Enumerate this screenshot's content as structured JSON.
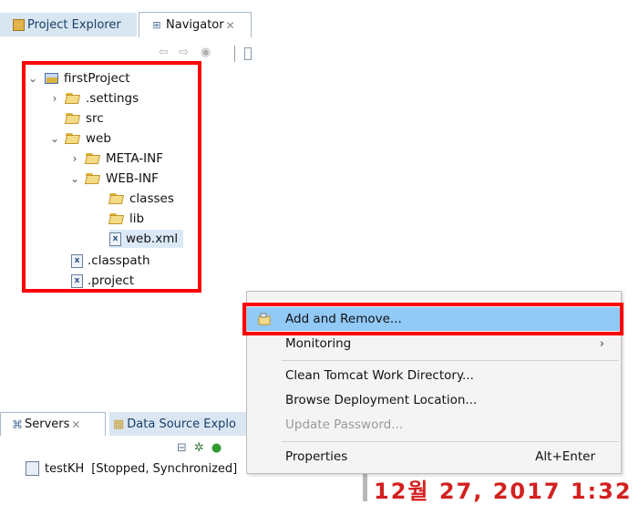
{
  "tabs": {
    "project_explorer": "Project Explorer",
    "navigator": "Navigator"
  },
  "tree": {
    "root": "firstProject",
    "settings": ".settings",
    "src": "src",
    "web": "web",
    "meta_inf": "META-INF",
    "web_inf": "WEB-INF",
    "classes": "classes",
    "lib": "lib",
    "web_xml": "web.xml",
    "classpath": ".classpath",
    "project": ".project"
  },
  "bottom": {
    "servers_tab": "Servers",
    "datasource_tab": "Data Source Explo",
    "server_name": "testKH",
    "server_status": "[Stopped, Synchronized]",
    "partial_date": "12월 27, 2017 1:32"
  },
  "menu": {
    "add_remove": "Add and Remove...",
    "monitoring": "Monitoring",
    "clean_tomcat": "Clean Tomcat Work Directory...",
    "browse_deploy": "Browse Deployment Location...",
    "update_password": "Update Password...",
    "properties": "Properties",
    "properties_shortcut": "Alt+Enter"
  },
  "colors": {
    "highlight": "#91c9f7",
    "annotation": "#ff0000"
  }
}
